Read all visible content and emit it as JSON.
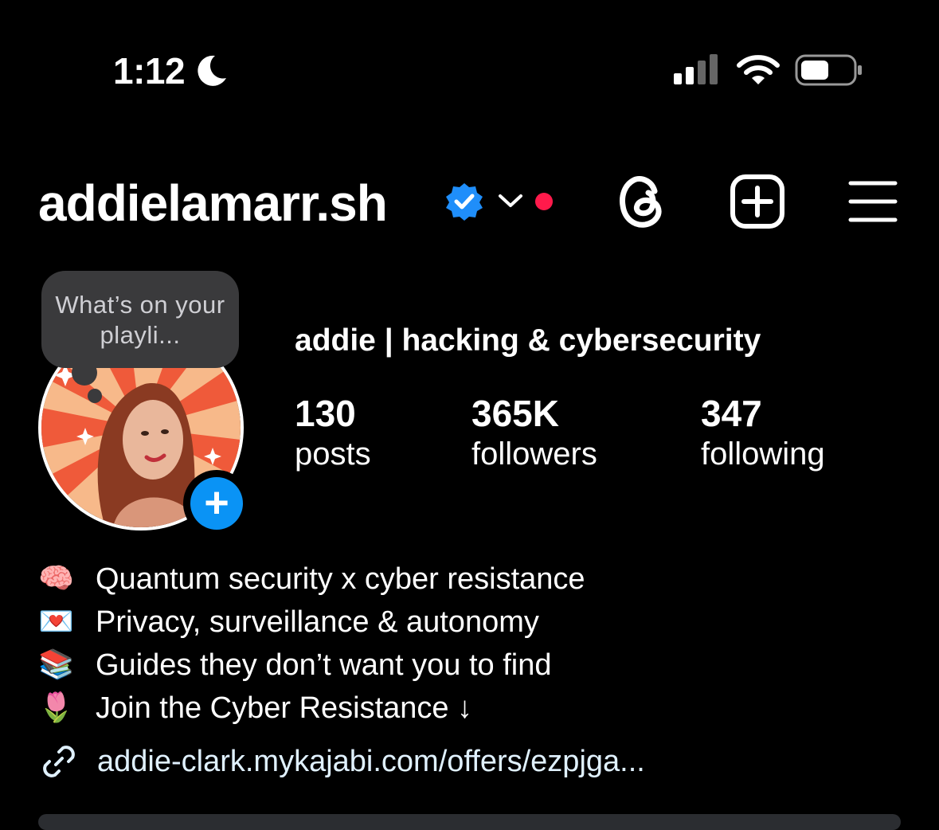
{
  "status_bar": {
    "time": "1:12",
    "focus_icon": "moon-icon",
    "signal_icon": "cellular-signal-icon",
    "wifi_icon": "wifi-icon",
    "battery_icon": "battery-icon"
  },
  "header": {
    "username": "addielamarr.sh",
    "verified_icon": "verified-badge-icon",
    "dropdown_icon": "chevron-down-icon",
    "notification_dot_color": "#ff1a4b",
    "actions": [
      "threads-icon",
      "create-post-icon",
      "menu-icon"
    ]
  },
  "profile": {
    "note": "What’s on your playli...",
    "display_name": "addie | hacking & cybersecurity",
    "stats": [
      {
        "value": "130",
        "label": "posts"
      },
      {
        "value": "365K",
        "label": "followers"
      },
      {
        "value": "347",
        "label": "following"
      }
    ],
    "add_story_color": "#0a93f5"
  },
  "bio": [
    {
      "emoji": "🧠",
      "text": "Quantum security x cyber resistance"
    },
    {
      "emoji": "💌",
      "text": "Privacy, surveillance & autonomy"
    },
    {
      "emoji": "📚",
      "text": "Guides they don’t want you to find"
    },
    {
      "emoji": "🌷",
      "text": "Join the Cyber Resistance ↓"
    }
  ],
  "link": {
    "icon": "link-icon",
    "text": "addie-clark.mykajabi.com/offers/ezpjga..."
  }
}
